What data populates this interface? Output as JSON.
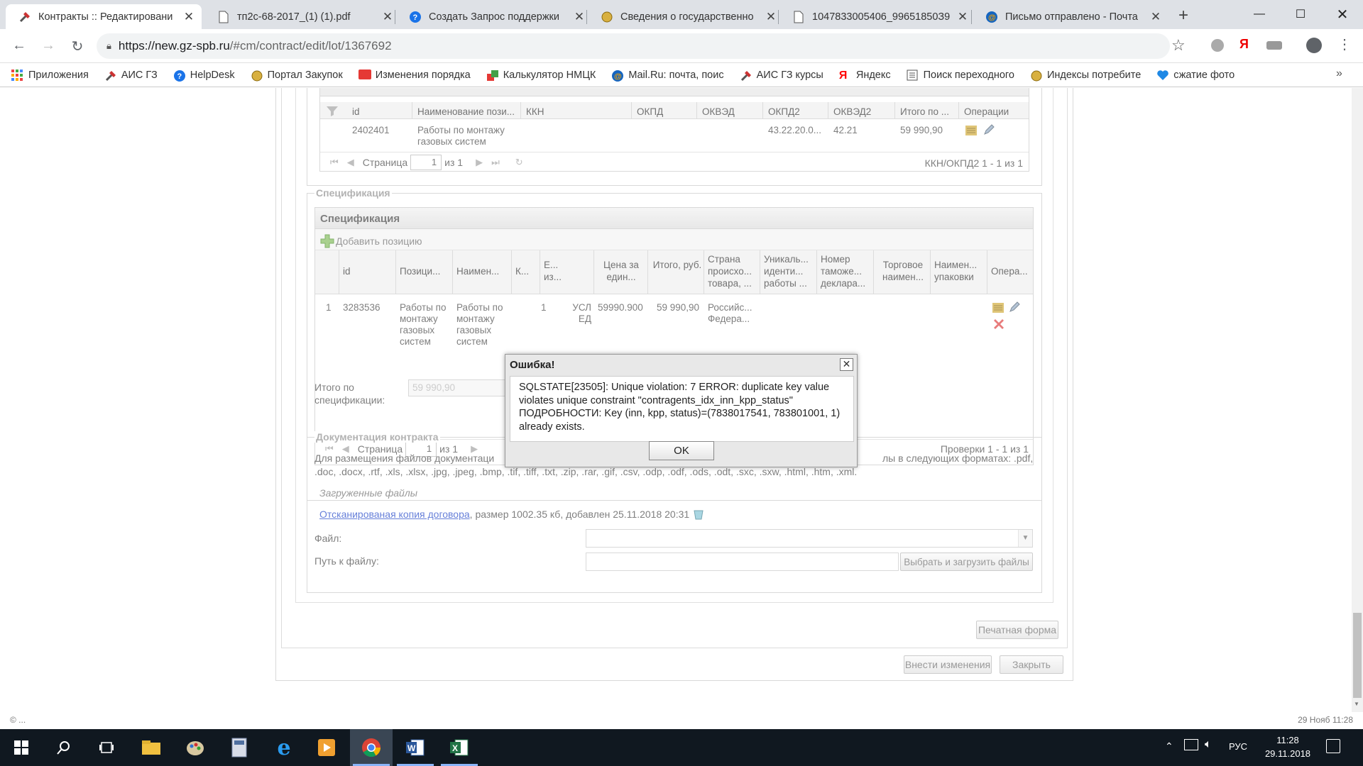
{
  "browser": {
    "tabs": [
      {
        "title": "Контракты :: Редактировани",
        "active": true,
        "icon": "tools-icon"
      },
      {
        "title": "тп2с-68-2017_(1) (1).pdf",
        "active": false,
        "icon": "document-icon"
      },
      {
        "title": "Создать Запрос поддержки",
        "active": false,
        "icon": "help-icon"
      },
      {
        "title": "Сведения о государственно",
        "active": false,
        "icon": "emblem-icon"
      },
      {
        "title": "1047833005406_99651850З9",
        "active": false,
        "icon": "document-icon"
      },
      {
        "title": "Письмо отправлено - Почта",
        "active": false,
        "icon": "mail-icon"
      }
    ],
    "url_domain": "https://new.gz-spb.ru",
    "url_rest": "/#cm/contract/edit/lot/1367692",
    "bookmarks": [
      {
        "label": "Приложения",
        "icon": "apps-icon"
      },
      {
        "label": "АИС ГЗ",
        "icon": "tools-icon"
      },
      {
        "label": "HelpDesk",
        "icon": "help-icon"
      },
      {
        "label": "Портал Закупок",
        "icon": "emblem-icon"
      },
      {
        "label": "Изменения порядка",
        "icon": "news-icon"
      },
      {
        "label": "Калькулятор НМЦК",
        "icon": "calculator-icon"
      },
      {
        "label": "Mail.Ru: почта, поис",
        "icon": "mail-icon"
      },
      {
        "label": "АИС ГЗ курсы",
        "icon": "tools-icon"
      },
      {
        "label": "Яндекс",
        "icon": "yandex-icon"
      },
      {
        "label": "Поиск переходного",
        "icon": "page-icon"
      },
      {
        "label": "Индексы потребите",
        "icon": "emblem-icon"
      },
      {
        "label": "сжатие фото",
        "icon": "heart-icon"
      }
    ],
    "bookmarks_more": "»"
  },
  "okpd_grid": {
    "headers": [
      "id",
      "Наименование пози...",
      "ККН",
      "ОКПД",
      "ОКВЭД",
      "ОКПД2",
      "ОКВЭД2",
      "Итого по ...",
      "Операции"
    ],
    "row": {
      "id": "2402401",
      "name": "Работы по монтажу газовых систем",
      "okpd2": "43.22.20.0...",
      "okved2": "42.21",
      "total": "59 990,90"
    },
    "pager": {
      "page_label": "Страница",
      "page": "1",
      "of": "из 1",
      "summary": "ККН/ОКПД2 1 - 1 из 1"
    }
  },
  "spec": {
    "legend": "Спецификация",
    "panel_title": "Спецификация",
    "add_label": "Добавить позицию",
    "headers": [
      "id",
      "Позици...",
      "Наимен...",
      "К...",
      "Е... из...",
      "Цена за един...",
      "Итого, руб.",
      "Страна происхо... товара, ...",
      "Уникаль... иденти... работы ...",
      "Номер таможе... деклара...",
      "Торговое наимен...",
      "Наимен... упаковки",
      "Опера..."
    ],
    "row": {
      "num": "1",
      "id": "3283536",
      "position": "Работы по монтажу газовых систем",
      "name": "Работы по монтажу газовых систем",
      "qty": "1",
      "unit": "УСЛ ЕД",
      "price": "59990.900",
      "total": "59 990,90",
      "country": "Российс... Федера..."
    },
    "pager": {
      "page_label": "Страница",
      "page": "1",
      "of": "из 1",
      "summary": "Проверки 1 - 1 из 1"
    },
    "total_label": "Итого по спецификации:",
    "total_value": "59 990,90"
  },
  "docs": {
    "legend": "Документация контракта",
    "hint_left": "Для размещения файлов документаци",
    "hint_right": "лы в следующих форматах: .pdf,",
    "hint_line2": ".doc, .docx, .rtf, .xls, .xlsx, .jpg, .jpeg, .bmp, .tif, .tiff, .txt, .zip, .rar, .gif, .csv, .odp, .odf, .ods, .odt, .sxc, .sxw, .html, .htm, .xml.",
    "uploaded_label": "Загруженные файлы",
    "file_link": "Отсканированая копия договора",
    "file_meta": ", размер 1002.35 кб, добавлен 25.11.2018 20:31",
    "file_label": "Файл:",
    "path_label": "Путь к файлу:",
    "upload_button": "Выбрать и загрузить файлы"
  },
  "actions": {
    "print": "Печатная форма",
    "save": "Внести изменения",
    "close": "Закрыть"
  },
  "modal": {
    "title": "Ошибка!",
    "message": "SQLSTATE[23505]: Unique violation: 7 ERROR: duplicate key value violates unique constraint \"contragents_idx_inn_kpp_status\" ПОДРОБНОСТИ: Key (inn, kpp, status)=(7838017541, 783801001, 1) already exists.",
    "ok": "OK"
  },
  "status": {
    "left": "© ...",
    "right": "29 Нояб 11:28"
  },
  "taskbar": {
    "lang": "РУС",
    "time": "11:28",
    "date": "29.11.2018"
  },
  "colors": {
    "link": "#3355cc",
    "taskbar": "#101820",
    "accent": "#8ab4f8"
  }
}
